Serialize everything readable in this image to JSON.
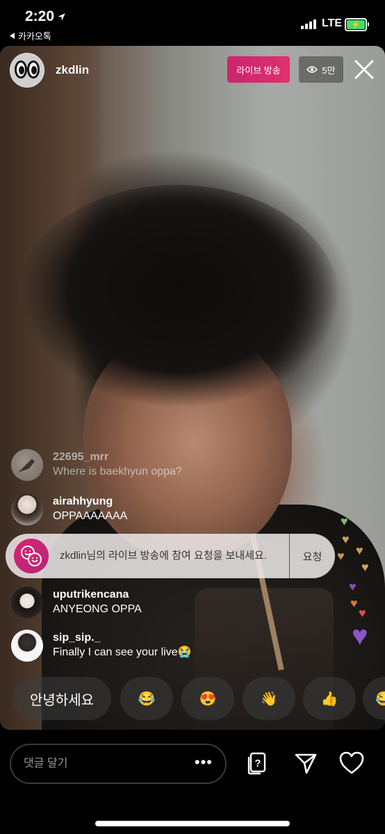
{
  "status_bar": {
    "time": "2:20",
    "back_app": "카카오톡",
    "network": "LTE"
  },
  "header": {
    "username": "zkdlin",
    "live_label": "라이브 방송",
    "viewer_count": "5만"
  },
  "comments": [
    {
      "user": "22695_mrr",
      "text": "Where is baekhyun oppa?"
    },
    {
      "user": "airahhyung",
      "text": "OPPAAAAAAA"
    },
    {
      "user": "uputrikencana",
      "text": "ANYEONG OPPA"
    },
    {
      "user": "sip_sip._",
      "text": "Finally I can see your live😭"
    }
  ],
  "join_request": {
    "text": "zkdlin님의 라이브 방송에 참여 요청을 보내세요.",
    "button": "요청"
  },
  "quick_replies": [
    "안녕하세요",
    "😂",
    "😍",
    "👋",
    "👍",
    "😂"
  ],
  "composer": {
    "placeholder": "댓글 달기"
  },
  "colors": {
    "live_badge": "#d42b6e",
    "battery": "#4cd964"
  },
  "icons": [
    "location-arrow-icon",
    "eye-icon",
    "close-icon",
    "more-icon",
    "question-cards-icon",
    "send-icon",
    "heart-icon"
  ]
}
